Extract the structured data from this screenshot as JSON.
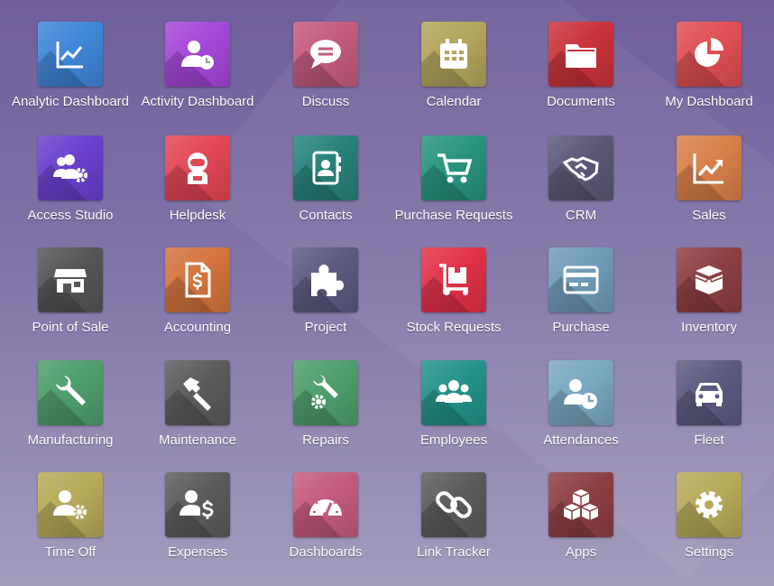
{
  "apps": [
    {
      "label": "Analytic Dashboard",
      "icon": "line-chart-icon",
      "color": "#3f86d8"
    },
    {
      "label": "Activity Dashboard",
      "icon": "user-clock-icon",
      "color": "#a447d9"
    },
    {
      "label": "Discuss",
      "icon": "chat-bubble-icon",
      "color": "#c45b7c"
    },
    {
      "label": "Calendar",
      "icon": "calendar-icon",
      "color": "#b3a55c"
    },
    {
      "label": "Documents",
      "icon": "folder-icon",
      "color": "#c9333a"
    },
    {
      "label": "My Dashboard",
      "icon": "pie-chart-icon",
      "color": "#df4f52"
    },
    {
      "label": "Access Studio",
      "icon": "users-gear-icon",
      "color": "#6a3fce"
    },
    {
      "label": "Helpdesk",
      "icon": "astronaut-icon",
      "color": "#e24656"
    },
    {
      "label": "Contacts",
      "icon": "address-book-icon",
      "color": "#28827b"
    },
    {
      "label": "Purchase Requests",
      "icon": "shopping-cart-icon",
      "color": "#28947e"
    },
    {
      "label": "CRM",
      "icon": "handshake-icon",
      "color": "#5b5877"
    },
    {
      "label": "Sales",
      "icon": "trend-chart-icon",
      "color": "#d8804a"
    },
    {
      "label": "Point of Sale",
      "icon": "store-icon",
      "color": "#555555"
    },
    {
      "label": "Accounting",
      "icon": "invoice-dollar-icon",
      "color": "#d3743e"
    },
    {
      "label": "Project",
      "icon": "puzzle-icon",
      "color": "#5c5a80"
    },
    {
      "label": "Stock Requests",
      "icon": "dolly-icon",
      "color": "#e13148"
    },
    {
      "label": "Purchase",
      "icon": "credit-card-icon",
      "color": "#6f9bb9"
    },
    {
      "label": "Inventory",
      "icon": "open-box-icon",
      "color": "#8c3f43"
    },
    {
      "label": "Manufacturing",
      "icon": "wrench-icon",
      "color": "#4e9e6c"
    },
    {
      "label": "Maintenance",
      "icon": "hammer-icon",
      "color": "#5b5b5b"
    },
    {
      "label": "Repairs",
      "icon": "wrench-gear-icon",
      "color": "#4e9e6c"
    },
    {
      "label": "Employees",
      "icon": "team-icon",
      "color": "#23928a"
    },
    {
      "label": "Attendances",
      "icon": "user-clock-icon",
      "color": "#79a8c0"
    },
    {
      "label": "Fleet",
      "icon": "car-icon",
      "color": "#5c5a80"
    },
    {
      "label": "Time Off",
      "icon": "user-gear-icon",
      "color": "#b7aa5a"
    },
    {
      "label": "Expenses",
      "icon": "user-dollar-icon",
      "color": "#5b5b5b"
    },
    {
      "label": "Dashboards",
      "icon": "gauge-icon",
      "color": "#c45b7c"
    },
    {
      "label": "Link Tracker",
      "icon": "link-icon",
      "color": "#5b5b5b"
    },
    {
      "label": "Apps",
      "icon": "cubes-icon",
      "color": "#8c3f43"
    },
    {
      "label": "Settings",
      "icon": "gear-icon",
      "color": "#b7aa5a"
    }
  ]
}
